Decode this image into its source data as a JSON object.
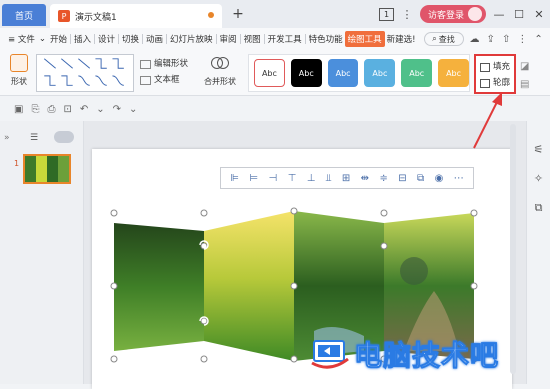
{
  "tabs": {
    "home": "首页",
    "document": "演示文稿1",
    "add": "+"
  },
  "window": {
    "box_icon": "1",
    "login": "访客登录",
    "minimize": "—",
    "restore": "☐",
    "close": "✕"
  },
  "menubar": {
    "file": "≡ 文件",
    "items": [
      "开始",
      "插入",
      "设计",
      "切换",
      "动画",
      "幻灯片放映",
      "审阅",
      "视图",
      "开发工具",
      "特色功能"
    ],
    "active": "绘图工具",
    "new_group": "新建选!",
    "search": "查找"
  },
  "ribbon": {
    "shape_label": "形状",
    "edit_shape": "编辑形状",
    "text_box": "文本框",
    "merge_shape": "合并形状",
    "style_label": "Abc",
    "styles": [
      {
        "bg": "#ffffff",
        "fg": "#333333",
        "border": "#e05a5a"
      },
      {
        "bg": "#000000",
        "fg": "#ffffff",
        "border": "#000000"
      },
      {
        "bg": "#4b8fdc",
        "fg": "#ffffff",
        "border": "#4b8fdc"
      },
      {
        "bg": "#5ab0e0",
        "fg": "#ffffff",
        "border": "#5ab0e0"
      },
      {
        "bg": "#4fc08a",
        "fg": "#ffffff",
        "border": "#4fc08a"
      },
      {
        "bg": "#f5b13d",
        "fg": "#ffffff",
        "border": "#f5b13d"
      }
    ],
    "fill": "填充",
    "outline": "轮廓"
  },
  "slide_panel": {
    "slide_number": "1"
  },
  "watermark": "电脑技术吧",
  "colors": {
    "accent": "#f06e3c",
    "highlight_box": "#e03a3a",
    "home_tab": "#4a7fd6"
  }
}
